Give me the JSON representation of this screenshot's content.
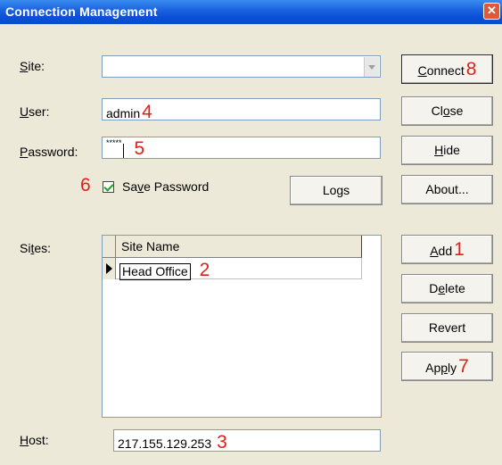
{
  "window": {
    "title": "Connection Management",
    "close_glyph": "✕"
  },
  "form": {
    "site_label_u": "S",
    "site_label_rest": "ite:",
    "site_value": "",
    "user_label_u": "U",
    "user_label_rest": "ser:",
    "user_value": "admin",
    "password_label_u": "P",
    "password_label_rest": "assword:",
    "password_value": "*****",
    "save_password_pre": "Sa",
    "save_password_u": "v",
    "save_password_post": "e Password",
    "save_password_checked": true,
    "sites_label_pre": "Si",
    "sites_label_u": "t",
    "sites_label_post": "es:",
    "host_label_u": "H",
    "host_label_rest": "ost:",
    "host_value": "217.155.129.253"
  },
  "buttons": {
    "connect_u": "C",
    "connect_rest": "onnect",
    "close_pre": "Cl",
    "close_u": "o",
    "close_post": "se",
    "hide_u": "H",
    "hide_rest": "ide",
    "about": "About...",
    "logs": "Logs",
    "add_u": "A",
    "add_rest": "dd",
    "delete_pre": "D",
    "delete_u": "e",
    "delete_post": "lete",
    "revert": "Revert",
    "apply_pre": "Ap",
    "apply_u": "p",
    "apply_post": "ly"
  },
  "sites_grid": {
    "column_header": "Site Name",
    "rows": [
      "Head Office"
    ]
  },
  "annotations": {
    "n1": "1",
    "n2": "2",
    "n3": "3",
    "n4": "4",
    "n5": "5",
    "n6": "6",
    "n7": "7",
    "n8": "8"
  },
  "colors": {
    "annotation": "#E0201A",
    "titlebar": "#0A50D8",
    "dialog_bg": "#ECE9D8"
  }
}
